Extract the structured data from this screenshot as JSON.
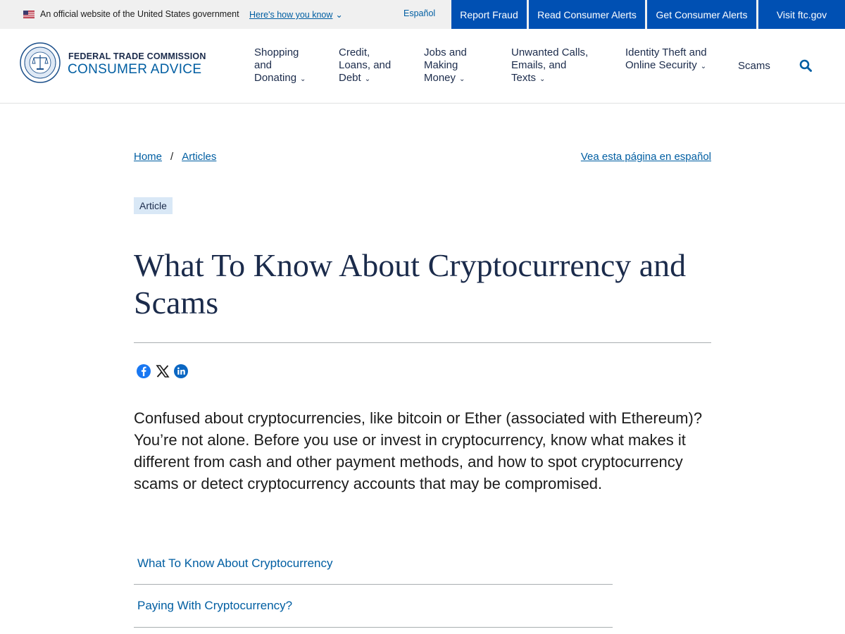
{
  "gov_banner": {
    "text": "An official website of the United States government",
    "link_label": "Here's how you know",
    "espanol_label": "Español"
  },
  "top_buttons": [
    "Report Fraud",
    "Read Consumer Alerts",
    "Get Consumer Alerts",
    "Visit ftc.gov"
  ],
  "brand": {
    "top": "FEDERAL TRADE COMMISSION",
    "bottom": "CONSUMER ADVICE"
  },
  "nav": {
    "items": [
      {
        "label": "Shopping and Donating"
      },
      {
        "label": "Credit, Loans, and Debt"
      },
      {
        "label": "Jobs and Making Money"
      },
      {
        "label": "Unwanted Calls, Emails, and Texts"
      },
      {
        "label": "Identity Theft and Online Security"
      }
    ],
    "scams_label": "Scams",
    "search_icon": "search-icon"
  },
  "breadcrumb": {
    "home": "Home",
    "separator": "/",
    "articles": "Articles",
    "spanish_link": "Vea esta página en español"
  },
  "tag": "Article",
  "title": "What To Know About Cryptocurrency and Scams",
  "share_icons": [
    "facebook-icon",
    "x-icon",
    "linkedin-icon"
  ],
  "intro": "Confused about cryptocurrencies, like bitcoin or Ether (associated with Ethereum)? You’re not alone. Before you use or invest in cryptocurrency, know what makes it different from cash and other payment methods, and how to spot cryptocurrency scams or detect cryptocurrency accounts that may be compromised.",
  "toc": [
    "What To Know About Cryptocurrency",
    "Paying With Cryptocurrency?"
  ],
  "colors": {
    "link": "#005ea2",
    "button_blue": "#0050b3",
    "title_navy": "#1b2b4b",
    "tag_bg": "#d9e8f6",
    "banner_bg": "#f0f0f0"
  }
}
